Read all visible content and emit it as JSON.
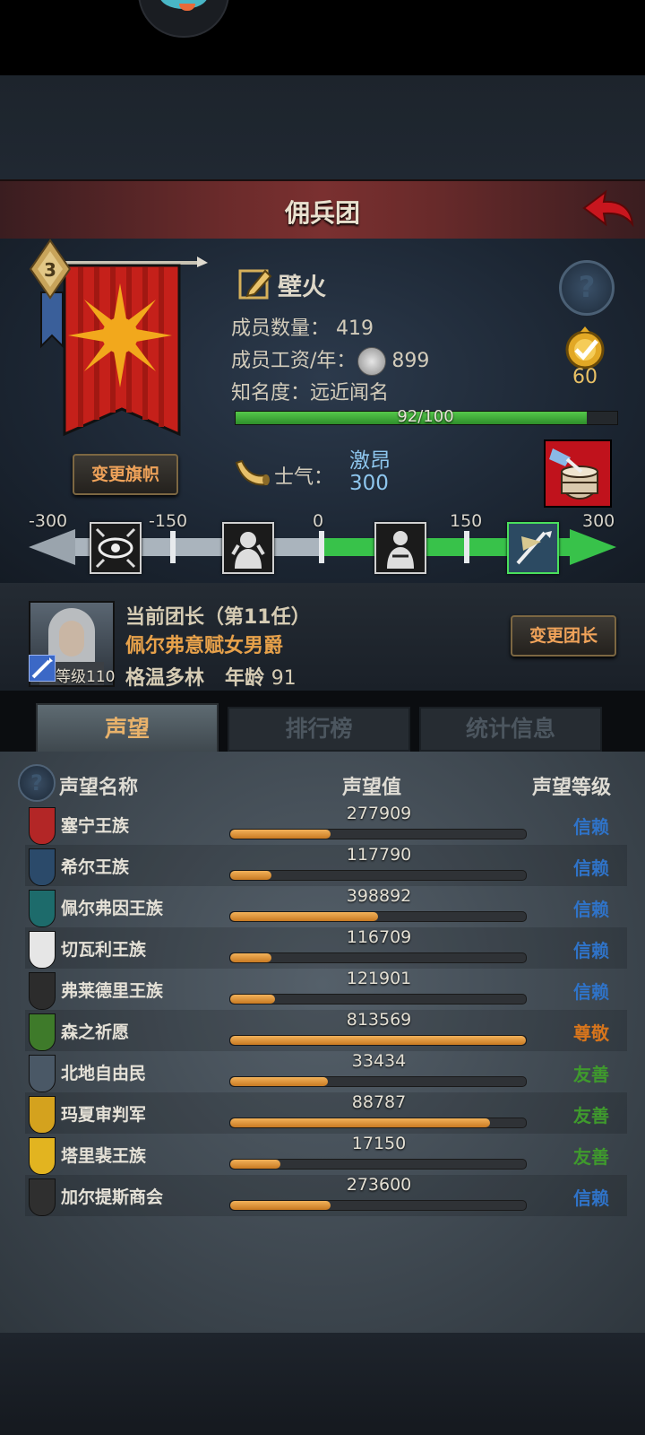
{
  "header": {
    "title": "佣兵团"
  },
  "guild": {
    "name": "壁火",
    "members_label": "成员数量：",
    "members_value": "419",
    "salary_label": "成员工资/年：",
    "salary_value": "899",
    "fame_label": "知名度：",
    "fame_value": "远近闻名",
    "fame_progress_text": "92/100",
    "fame_progress": 0.92,
    "medal_value": "60",
    "change_flag_label": "变更旗帜",
    "banner_level": "3"
  },
  "morale": {
    "label": "士气：",
    "word": "激昂",
    "value": "300",
    "scale_labels": [
      "-300",
      "-150",
      "0",
      "150",
      "300"
    ],
    "scale_min": -300,
    "scale_max": 300
  },
  "leader": {
    "title": "当前团长（第11任）",
    "name": "佩尔弗意赋女男爵",
    "origin": "格温多林",
    "age_label": "年龄",
    "age": "91",
    "level_text": "等级110",
    "change_label": "变更团长"
  },
  "tabs": [
    {
      "label": "声望",
      "active": true
    },
    {
      "label": "排行榜",
      "active": false
    },
    {
      "label": "统计信息",
      "active": false
    }
  ],
  "reputation": {
    "headers": {
      "name": "声望名称",
      "value": "声望值",
      "level": "声望等级"
    },
    "rows": [
      {
        "name": "塞宁王族",
        "value": "277909",
        "progress": 0.34,
        "level": "信赖",
        "level_color": "#2f73c8",
        "emblem": "#b32626"
      },
      {
        "name": "希尔王族",
        "value": "117790",
        "progress": 0.14,
        "level": "信赖",
        "level_color": "#2f73c8",
        "emblem": "#2b4a6a"
      },
      {
        "name": "佩尔弗因王族",
        "value": "398892",
        "progress": 0.5,
        "level": "信赖",
        "level_color": "#2f73c8",
        "emblem": "#1d6b6b"
      },
      {
        "name": "切瓦利王族",
        "value": "116709",
        "progress": 0.14,
        "level": "信赖",
        "level_color": "#2f73c8",
        "emblem": "#e6e6e6"
      },
      {
        "name": "弗莱德里王族",
        "value": "121901",
        "progress": 0.15,
        "level": "信赖",
        "level_color": "#2f73c8",
        "emblem": "#2c2c2c"
      },
      {
        "name": "森之祈愿",
        "value": "813569",
        "progress": 1.0,
        "level": "尊敬",
        "level_color": "#d7751c",
        "emblem": "#3e7a2a"
      },
      {
        "name": "北地自由民",
        "value": "33434",
        "progress": 0.33,
        "level": "友善",
        "level_color": "#3f9a2d",
        "emblem": "#4a5866"
      },
      {
        "name": "玛夏审判军",
        "value": "88787",
        "progress": 0.88,
        "level": "友善",
        "level_color": "#3f9a2d",
        "emblem": "#d4a21e"
      },
      {
        "name": "塔里裴王族",
        "value": "17150",
        "progress": 0.17,
        "level": "友善",
        "level_color": "#3f9a2d",
        "emblem": "#e2b420"
      },
      {
        "name": "加尔提斯商会",
        "value": "273600",
        "progress": 0.34,
        "level": "信赖",
        "level_color": "#2f73c8",
        "emblem": "#2f2f2f"
      }
    ]
  }
}
